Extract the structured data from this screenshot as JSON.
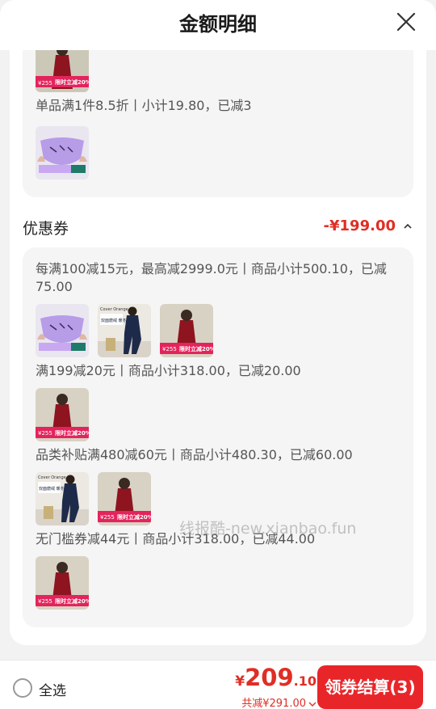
{
  "header": {
    "title": "金额明细",
    "close_icon": "close-icon"
  },
  "product_card": {
    "rule": "单品满1件8.5折丨小计19.80，已减3",
    "thumbs": [
      "red-dress-product-image",
      "purple-briefs-product-image"
    ]
  },
  "coupon_section": {
    "title": "优惠券",
    "amount": "-¥199.00",
    "chevron_icon": "chevron-up-icon",
    "groups": [
      {
        "rule": "每满100减15元，最高减2999.0元丨商品小计500.10，已减75.00",
        "thumbs": [
          "purple-briefs-product-image",
          "navy-pajama-product-image",
          "red-dress-product-image"
        ]
      },
      {
        "rule": "满199减20元丨商品小计318.00，已减20.00",
        "thumbs": [
          "red-dress-product-image"
        ]
      },
      {
        "rule": "品类补贴满480减60元丨商品小计480.30，已减60.00",
        "thumbs": [
          "navy-pajama-product-image",
          "red-dress-product-image"
        ]
      },
      {
        "rule": "无门槛券减44元丨商品小计318.00，已减44.00",
        "thumbs": [
          "red-dress-product-image"
        ]
      }
    ]
  },
  "product_badges": {
    "price_tag": "¥255",
    "sale_tag": "限时立减20%",
    "navy_brand": "Cover Orange",
    "navy_caption": "双面磨绒 暖冬神器"
  },
  "watermark": "线报酷-new.xianbao.fun",
  "bottom_bar": {
    "select_all": "全选",
    "price_symbol": "¥",
    "price_integer": "209",
    "price_decimal": ".10",
    "total_discount": "共减¥291.00",
    "checkout_button": "领券结算(3)"
  },
  "colors": {
    "accent": "#e02e24",
    "button": "#e8262a",
    "card_bg": "#f5f5f5",
    "page_bg": "#f2f2f2"
  }
}
